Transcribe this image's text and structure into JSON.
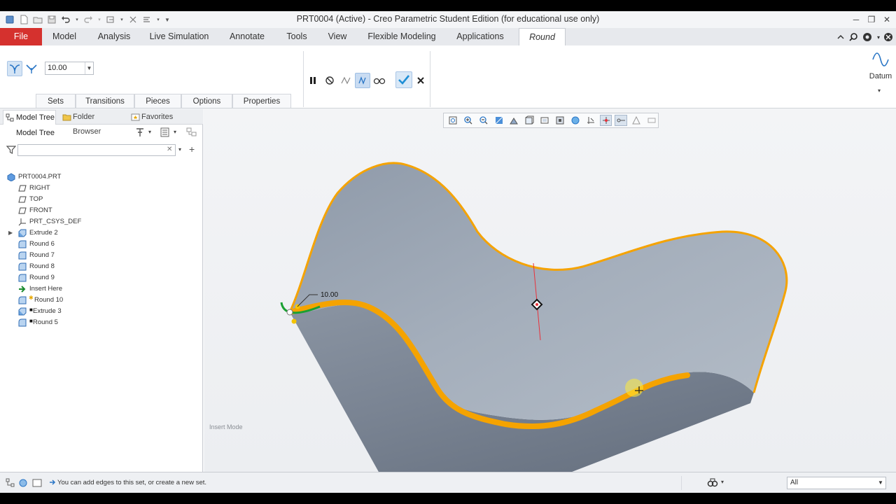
{
  "window": {
    "title": "PRT0004 (Active) - Creo Parametric Student Edition (for educational use only)"
  },
  "menu_tabs": [
    "File",
    "Model",
    "Analysis",
    "Live Simulation",
    "Annotate",
    "Tools",
    "View",
    "Flexible Modeling",
    "Applications",
    "Round"
  ],
  "ribbon": {
    "radius_value": "10.00",
    "datum_label": "Datum",
    "dashboard_tabs": [
      "Sets",
      "Transitions",
      "Pieces",
      "Options",
      "Properties"
    ]
  },
  "panel": {
    "tabs": [
      "Model Tree",
      "Folder Browser",
      "Favorites"
    ],
    "tree_title": "Model Tree",
    "filter_placeholder": "",
    "tree_items": [
      {
        "label": "PRT0004.PRT",
        "icon": "part-icon"
      },
      {
        "label": "RIGHT",
        "icon": "datum-plane-icon"
      },
      {
        "label": "TOP",
        "icon": "datum-plane-icon"
      },
      {
        "label": "FRONT",
        "icon": "datum-plane-icon"
      },
      {
        "label": "PRT_CSYS_DEF",
        "icon": "csys-icon"
      },
      {
        "label": "Extrude 2",
        "icon": "extrude-icon"
      },
      {
        "label": "Round 6",
        "icon": "round-icon"
      },
      {
        "label": "Round 7",
        "icon": "round-icon"
      },
      {
        "label": "Round 8",
        "icon": "round-icon"
      },
      {
        "label": "Round 9",
        "icon": "round-icon"
      },
      {
        "label": "Insert Here",
        "icon": "insert-arrow-icon"
      },
      {
        "label": "Round 10",
        "icon": "round-icon"
      },
      {
        "label": "Extrude 3",
        "icon": "extrude-icon"
      },
      {
        "label": "Round 5",
        "icon": "round-icon"
      }
    ]
  },
  "viewport": {
    "dimension_label": "10.00",
    "mode_label": "Insert Mode"
  },
  "status": {
    "message": "You can add edges to this set, or create a new set.",
    "filter_value": "All"
  },
  "colors": {
    "file_tab": "#d5312e",
    "highlight_edge": "#f5a300",
    "model_surface": "#9aa4b1",
    "accent_check": "#1e8fd6"
  }
}
